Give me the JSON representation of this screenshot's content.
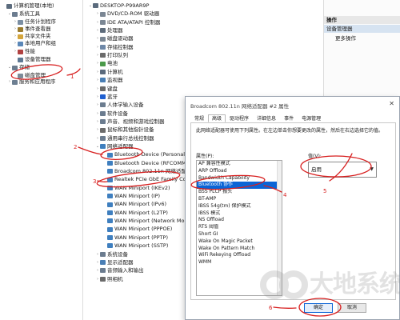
{
  "left_tree": [
    {
      "label": "计算机管理(本地)",
      "icon": "computer-icon",
      "color": "#5b6b7d",
      "indent": 0,
      "chev": ""
    },
    {
      "label": "系统工具",
      "icon": "tools-icon",
      "color": "#6b7c8f",
      "indent": 1,
      "chev": "v"
    },
    {
      "label": "任务计划程序",
      "icon": "clock-icon",
      "color": "#7a8ea3",
      "indent": 2,
      "chev": ">"
    },
    {
      "label": "事件查看器",
      "icon": "event-icon",
      "color": "#9a7b2e",
      "indent": 2,
      "chev": ">"
    },
    {
      "label": "共享文件夹",
      "icon": "folder-icon",
      "color": "#d4a53c",
      "indent": 2,
      "chev": ">"
    },
    {
      "label": "本地用户和组",
      "icon": "users-icon",
      "color": "#5a87b8",
      "indent": 2,
      "chev": ">"
    },
    {
      "label": "性能",
      "icon": "performance-icon",
      "color": "#b04141",
      "indent": 2,
      "chev": ">"
    },
    {
      "label": "设备管理器",
      "icon": "device-manager-icon",
      "color": "#5d7893",
      "indent": 2,
      "chev": ""
    },
    {
      "label": "存储",
      "icon": "storage-icon",
      "color": "#6b7c8f",
      "indent": 1,
      "chev": "v"
    },
    {
      "label": "磁盘管理",
      "icon": "disk-icon",
      "color": "#7d8b99",
      "indent": 2,
      "chev": ""
    },
    {
      "label": "服务和应用程序",
      "icon": "services-icon",
      "color": "#6d7f92",
      "indent": 1,
      "chev": ">"
    }
  ],
  "device_tree": [
    {
      "label": "DESKTOP-P99AR9P",
      "icon": "computer-icon",
      "color": "#5b6b7d",
      "indent": 0,
      "chev": "v"
    },
    {
      "label": "DVD/CD-ROM 驱动器",
      "icon": "dvd-icon",
      "color": "#7b8794",
      "indent": 1,
      "chev": ">"
    },
    {
      "label": "IDE ATA/ATAPI 控制器",
      "icon": "ide-icon",
      "color": "#7b8794",
      "indent": 1,
      "chev": ">"
    },
    {
      "label": "处理器",
      "icon": "cpu-icon",
      "color": "#5e6c7b",
      "indent": 1,
      "chev": ">"
    },
    {
      "label": "磁盘驱动器",
      "icon": "disk-icon",
      "color": "#7b8794",
      "indent": 1,
      "chev": ">"
    },
    {
      "label": "存储控制器",
      "icon": "storage-icon",
      "color": "#6e88a8",
      "indent": 1,
      "chev": ">"
    },
    {
      "label": "打印队列",
      "icon": "printer-icon",
      "color": "#6b6b6b",
      "indent": 1,
      "chev": ">"
    },
    {
      "label": "电池",
      "icon": "battery-icon",
      "color": "#4a9a4a",
      "indent": 1,
      "chev": ">"
    },
    {
      "label": "计算机",
      "icon": "computer-icon",
      "color": "#5b6b7d",
      "indent": 1,
      "chev": ">"
    },
    {
      "label": "监视器",
      "icon": "monitor-icon",
      "color": "#4a7fb5",
      "indent": 1,
      "chev": ">"
    },
    {
      "label": "键盘",
      "icon": "keyboard-icon",
      "color": "#6b6b6b",
      "indent": 1,
      "chev": ">"
    },
    {
      "label": "蓝牙",
      "icon": "bluetooth-icon",
      "color": "#1f5fd0",
      "indent": 1,
      "chev": ">"
    },
    {
      "label": "人体学输入设备",
      "icon": "hid-icon",
      "color": "#6b7c8f",
      "indent": 1,
      "chev": ">"
    },
    {
      "label": "软件设备",
      "icon": "software-device-icon",
      "color": "#6b7c8f",
      "indent": 1,
      "chev": ">"
    },
    {
      "label": "声音、视频和游戏控制器",
      "icon": "sound-icon",
      "color": "#6b7c8f",
      "indent": 1,
      "chev": ">"
    },
    {
      "label": "鼠标和其他指针设备",
      "icon": "mouse-icon",
      "color": "#6b6b6b",
      "indent": 1,
      "chev": ">"
    },
    {
      "label": "通用串行总线控制器",
      "icon": "usb-icon",
      "color": "#6b7c8f",
      "indent": 1,
      "chev": ">"
    },
    {
      "label": "网络适配器",
      "icon": "network-adapter-icon",
      "color": "#3f7fbf",
      "indent": 1,
      "chev": "v"
    },
    {
      "label": "Bluetooth Device (Personal A",
      "icon": "network-adapter-icon",
      "color": "#3f7fbf",
      "indent": 2,
      "chev": ""
    },
    {
      "label": "Bluetooth Device (RFCOMM I",
      "icon": "network-adapter-icon",
      "color": "#3f7fbf",
      "indent": 2,
      "chev": ""
    },
    {
      "label": "Broadcom 802.11n 网络适配器",
      "icon": "network-adapter-icon",
      "color": "#3f7fbf",
      "indent": 2,
      "chev": ""
    },
    {
      "label": "Realtek PCIe GbE Family Con",
      "icon": "network-adapter-icon",
      "color": "#3f7fbf",
      "indent": 2,
      "chev": ""
    },
    {
      "label": "WAN Miniport (IKEv2)",
      "icon": "network-adapter-icon",
      "color": "#3f7fbf",
      "indent": 2,
      "chev": ""
    },
    {
      "label": "WAN Miniport (IP)",
      "icon": "network-adapter-icon",
      "color": "#3f7fbf",
      "indent": 2,
      "chev": ""
    },
    {
      "label": "WAN Miniport (IPv6)",
      "icon": "network-adapter-icon",
      "color": "#3f7fbf",
      "indent": 2,
      "chev": ""
    },
    {
      "label": "WAN Miniport (L2TP)",
      "icon": "network-adapter-icon",
      "color": "#3f7fbf",
      "indent": 2,
      "chev": ""
    },
    {
      "label": "WAN Miniport (Network Mo",
      "icon": "network-adapter-icon",
      "color": "#3f7fbf",
      "indent": 2,
      "chev": ""
    },
    {
      "label": "WAN Miniport (PPPOE)",
      "icon": "network-adapter-icon",
      "color": "#3f7fbf",
      "indent": 2,
      "chev": ""
    },
    {
      "label": "WAN Miniport (PPTP)",
      "icon": "network-adapter-icon",
      "color": "#3f7fbf",
      "indent": 2,
      "chev": ""
    },
    {
      "label": "WAN Miniport (SSTP)",
      "icon": "network-adapter-icon",
      "color": "#3f7fbf",
      "indent": 2,
      "chev": ""
    },
    {
      "label": "系统设备",
      "icon": "system-device-icon",
      "color": "#6b7c8f",
      "indent": 1,
      "chev": ">"
    },
    {
      "label": "显示适配器",
      "icon": "display-adapter-icon",
      "color": "#4a7fb5",
      "indent": 1,
      "chev": ">"
    },
    {
      "label": "音频输入和输出",
      "icon": "audio-icon",
      "color": "#6b7c8f",
      "indent": 1,
      "chev": ">"
    },
    {
      "label": "照相机",
      "icon": "camera-icon",
      "color": "#6b6b6b",
      "indent": 1,
      "chev": ">"
    }
  ],
  "actions": {
    "header": "操作",
    "section": "设备管理器",
    "more": "更多操作"
  },
  "dialog": {
    "title": "Broadcom 802.11n 网络适配器 #2 属性",
    "close": "✕",
    "tabs": [
      "常规",
      "高级",
      "驱动程序",
      "详细信息",
      "事件",
      "电源管理"
    ],
    "active_tab": 1,
    "description": "此网络适配器可使用下列属性。在左边单击你想要更改的属性，然后在右边选择它的值。",
    "property_label": "属性(P):",
    "value_label": "值(V):",
    "properties": [
      "AP 兼容性模式",
      "ARP Offload",
      "Bandwidth Capability",
      "Bluetooth 协作",
      "BSS PLCP 报头",
      "BT-AMP",
      "IBSS 54g(tm) 保护模式",
      "IBSS 模式",
      "NS Offload",
      "RTS 阈值",
      "Short GI",
      "Wake On Magic Packet",
      "Wake On Pattern Match",
      "WiFi Rekeying Offload",
      "WMM"
    ],
    "selected_property": 3,
    "value": "启用",
    "ok_label": "确定",
    "cancel_label": "取消"
  },
  "annotations": {
    "color": "#d71f1f",
    "steps": [
      "1",
      "2",
      "3",
      "4",
      "5",
      "6"
    ]
  },
  "watermark": {
    "text": "大地系统"
  }
}
